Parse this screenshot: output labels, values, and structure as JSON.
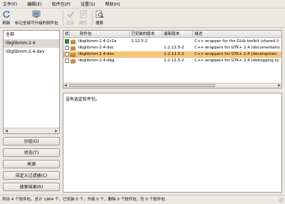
{
  "menubar": {
    "items": [
      "文件(F)",
      "编辑(E)",
      "软件包(P)",
      "设置(S)",
      "帮助(H)"
    ]
  },
  "toolbar": {
    "buttons": [
      {
        "label": "刷新",
        "icon": "reload-icon",
        "enabled": true
      },
      {
        "label": "标记全部可升级的软件包",
        "icon": "mark-all-upgrades-icon",
        "enabled": true
      },
      {
        "label": "应用",
        "icon": "apply-checkmark-icon",
        "enabled": false
      },
      {
        "label": "属性",
        "icon": "properties-icon",
        "enabled": false
      },
      {
        "label": "搜索",
        "icon": "search-icon",
        "enabled": true
      }
    ]
  },
  "sidebar": {
    "items": [
      {
        "label": "全部",
        "selected": false
      },
      {
        "label": "libglibmm-2.4",
        "selected": true
      },
      {
        "label": "libglibmm-2.4-dev",
        "selected": false
      }
    ],
    "buttons": [
      "分组(G)",
      "状态(T)",
      "来源",
      "自定义过滤器(C)",
      "搜索结果(R)"
    ]
  },
  "package_list": {
    "columns": [
      "状态",
      "软件包",
      "已安装的版本",
      "最新版本",
      "描述"
    ],
    "rows": [
      {
        "status": "installed",
        "name": "libglibmm-2.4-1c2a",
        "installed_version": "2.12.5-2",
        "latest_version": "",
        "description": "C++ wrapper for the GLib toolkit (shared li",
        "selected": false
      },
      {
        "status": "none",
        "name": "libglibmm-2.4-doc",
        "installed_version": "",
        "latest_version": "1:2.12.5-2",
        "description": "C++ wrappers for GTK+ 2.4 (documentatio",
        "selected": false
      },
      {
        "status": "none",
        "name": "libglibmm-2.4-dev",
        "installed_version": "",
        "latest_version": "1:2.12.5-2",
        "description": "C++ wrappers for GTK+ 2.4 (developmen",
        "selected": true
      },
      {
        "status": "none",
        "name": "libglibmm-2.4-dbg",
        "installed_version": "",
        "latest_version": "1:2.12.5-2",
        "description": "C++ wrappers for GTK+ 2.4 (debugging sy",
        "selected": false
      }
    ]
  },
  "details": {
    "text": "没有选定软件包。"
  },
  "statusbar": {
    "text": "列出 4 个软件包，总计 1964 个，已安装 0 个，升级 0 个，删除 0 个软件包，仍 0 个软件包"
  },
  "colors": {
    "selection": "#f5c57a",
    "installed": "#3b8a3b"
  }
}
